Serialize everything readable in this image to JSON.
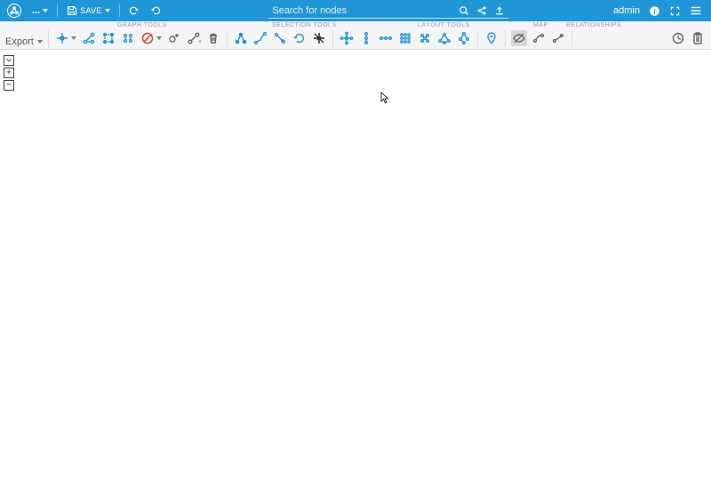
{
  "topbar": {
    "more_label": "...",
    "save_label": "SAVE",
    "search_placeholder": "Search for nodes",
    "user": "admin"
  },
  "ribbon": {
    "export_label": "Export",
    "group_labels": {
      "graph_tools": "GRAPH TOOLS",
      "selection_tools": "SELECTION TOOLS",
      "layout_tools": "LAYOUT TOOLS",
      "map": "MAP",
      "relationships": "RELATIONSHIPS"
    }
  },
  "sidestrip": {
    "toggle": "",
    "plus": "+",
    "minus": "−"
  }
}
